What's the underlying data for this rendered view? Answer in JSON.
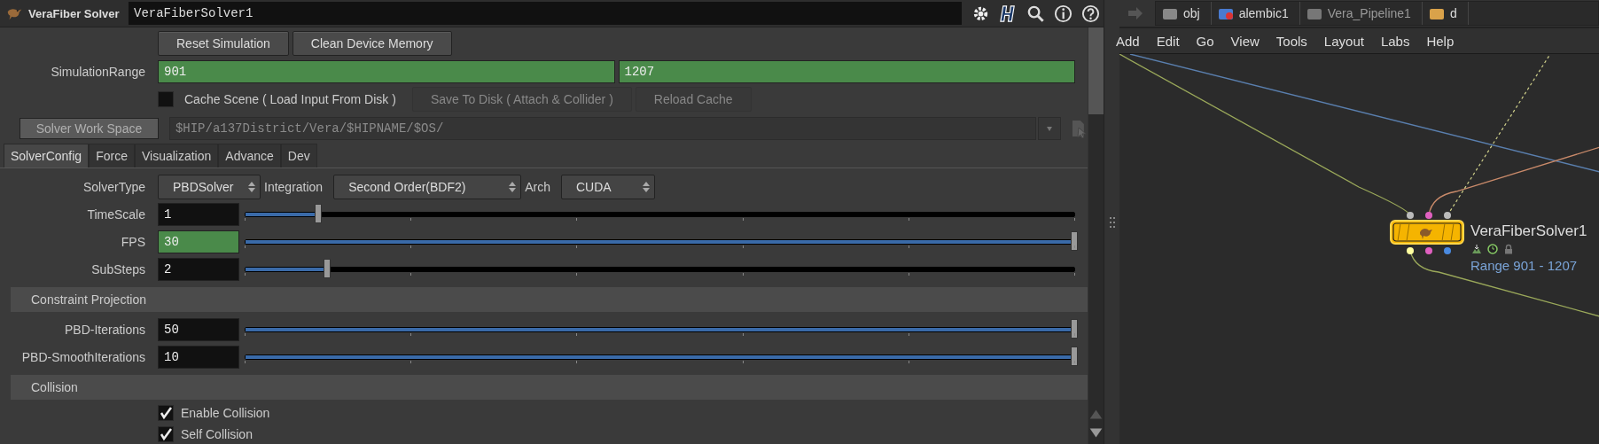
{
  "parameter_pane": {
    "node_type": "VeraFiber Solver",
    "node_name": "VeraFiberSolver1",
    "top_buttons": [
      "Reset Simulation",
      "Clean Device Memory"
    ],
    "simulation_range": {
      "label": "SimulationRange",
      "start": "901",
      "end": "1207",
      "keyed": true
    },
    "cache_scene": {
      "label": "Cache Scene ( Load Input From Disk )",
      "checked": false
    },
    "cache_buttons": [
      {
        "label": "Save To Disk ( Attach & Collider )",
        "disabled": true
      },
      {
        "label": "Reload Cache",
        "disabled": true
      }
    ],
    "work_space": {
      "label": "Solver Work Space",
      "value": "$HIP/a137District/Vera/$HIPNAME/$OS/",
      "disabled": true
    },
    "tabs": [
      {
        "label": "SolverConfig",
        "selected": true
      },
      {
        "label": "Force",
        "selected": false
      },
      {
        "label": "Visualization",
        "selected": false
      },
      {
        "label": "Advance",
        "selected": false
      },
      {
        "label": "Dev",
        "selected": false
      }
    ],
    "menus": [
      {
        "label": "SolverType",
        "value": "PBDSolver"
      },
      {
        "label": "Integration",
        "value": "Second Order(BDF2)"
      },
      {
        "label": "Arch",
        "value": "CUDA"
      }
    ],
    "params": [
      {
        "kind": "slider",
        "label": "TimeScale",
        "value": "1",
        "level": 0.09,
        "keyed": false
      },
      {
        "kind": "slider",
        "label": "FPS",
        "value": "30",
        "level": 1,
        "keyed": true
      },
      {
        "kind": "slider",
        "label": "SubSteps",
        "value": "2",
        "level": 0.1,
        "keyed": false
      },
      {
        "kind": "section",
        "label": "Constraint Projection"
      },
      {
        "kind": "slider",
        "label": "PBD-Iterations",
        "value": "50",
        "level": 1,
        "keyed": false
      },
      {
        "kind": "slider",
        "label": "PBD-SmoothIterations",
        "value": "10",
        "level": 1,
        "keyed": false
      },
      {
        "kind": "section",
        "label": "Collision"
      },
      {
        "kind": "checkbox",
        "label": "Enable Collision",
        "checked": true
      },
      {
        "kind": "checkbox",
        "label": "Self Collision",
        "checked": true
      }
    ]
  },
  "network": {
    "path": [
      {
        "label": "obj",
        "dimmed": false
      },
      {
        "label": "alembic1",
        "dimmed": false
      },
      {
        "label": "Vera_Pipeline1",
        "dimmed": true
      },
      {
        "label": "d",
        "dimmed": false
      }
    ],
    "menu": [
      "Add",
      "Edit",
      "Go",
      "View",
      "Tools",
      "Layout",
      "Labs",
      "Help"
    ],
    "node": {
      "name": "VeraFiberSolver1",
      "comment": "Range 901 - 1207"
    }
  }
}
